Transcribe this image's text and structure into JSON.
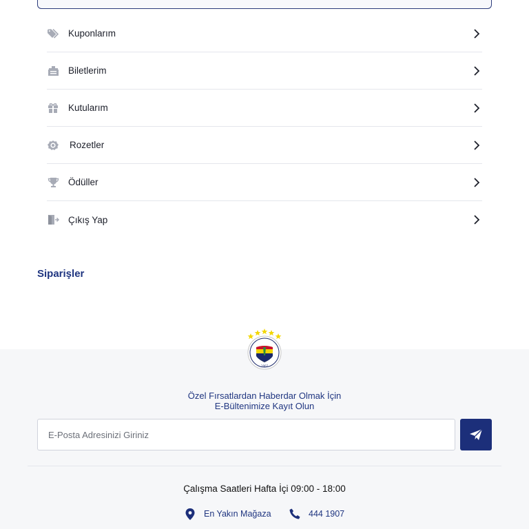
{
  "menu": {
    "items": [
      {
        "label": "Kuponlarım",
        "icon": "tag-icon"
      },
      {
        "label": "Biletlerim",
        "icon": "ticket-icon"
      },
      {
        "label": "Kutularım",
        "icon": "gift-icon"
      },
      {
        "label": "Rozetler",
        "icon": "badge-icon"
      },
      {
        "label": "Ödüller",
        "icon": "trophy-icon"
      },
      {
        "label": "Çıkış Yap",
        "icon": "logout-icon"
      }
    ]
  },
  "orders": {
    "title": "Siparişler"
  },
  "footer": {
    "newsletter_line1": "Özel Fırsatlardan Haberdar Olmak İçin",
    "newsletter_line2": "E-Bültenimize Kayıt Olun",
    "email_placeholder": "E-Posta Adresinizi Giriniz",
    "hours": "Çalışma Saatleri Hafta İçi 09:00 - 18:00",
    "store_link": "En Yakın Mağaza",
    "phone": "444 1907"
  },
  "colors": {
    "brand": "#1c2f7a",
    "icon_gray": "#a7abb6",
    "link_blue": "#1f3580"
  }
}
